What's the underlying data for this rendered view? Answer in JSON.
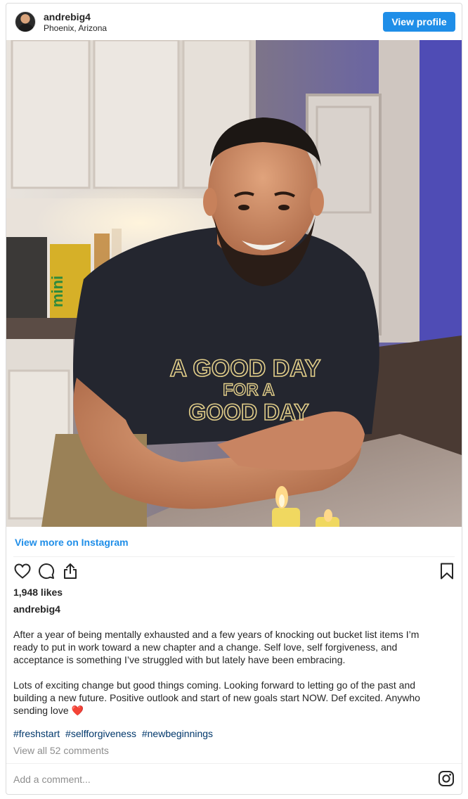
{
  "header": {
    "username": "andrebig4",
    "location": "Phoenix, Arizona",
    "view_profile_label": "View profile"
  },
  "photo": {
    "shirt_text_line1": "A GOOD DAY",
    "shirt_text_line2": "FOR A",
    "shirt_text_line3": "GOOD DAY",
    "can_text": "mini"
  },
  "view_more_label": "View more on Instagram",
  "actions": {
    "icons": [
      "heart-icon",
      "comment-icon",
      "share-icon",
      "bookmark-icon"
    ]
  },
  "likes": "1,948 likes",
  "caption": {
    "username": "andrebig4",
    "paragraph1": "After a year of being mentally exhausted and a few years of knocking out bucket list items I’m ready to put in work toward a new chapter and a change. Self love, self forgiveness, and acceptance is something I’ve struggled with but lately have been embracing.",
    "paragraph2": "Lots of exciting change but good things coming. Looking forward to letting go of the past and building a new future. Positive outlook and start of new goals start NOW. Def excited. Anywho sending love",
    "heart_emoji": "❤️"
  },
  "hashtags": [
    "#freshstart",
    "#selfforgiveness",
    "#newbeginnings"
  ],
  "comments_link": "View all 52 comments",
  "comment_input": {
    "placeholder": "Add a comment..."
  },
  "colors": {
    "accent": "#1f8ee8",
    "hashtag": "#00376b",
    "muted": "#8e8e8e",
    "text": "#262626",
    "heart": "#e01b3c"
  }
}
